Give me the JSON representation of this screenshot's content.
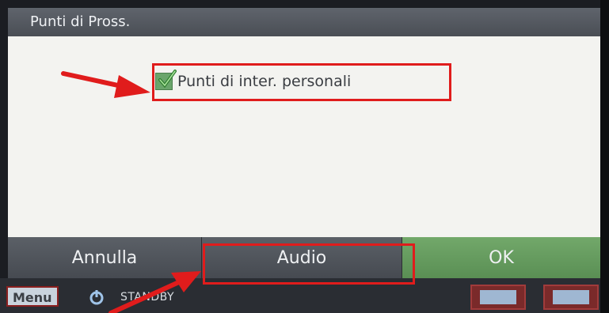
{
  "title": "Punti di Pross.",
  "content": {
    "checkbox_label": "Punti di inter. personali",
    "checked": true
  },
  "buttons": {
    "cancel": "Annulla",
    "audio": "Audio",
    "ok": "OK"
  },
  "status": {
    "menu": "Menu",
    "standby": "STANDBY"
  },
  "icons": [
    "check-icon",
    "standby-power-icon"
  ],
  "colors": {
    "highlight": "#e01c1c",
    "ok_button": "#6a9f62",
    "checkbox": "#6aa56b"
  }
}
